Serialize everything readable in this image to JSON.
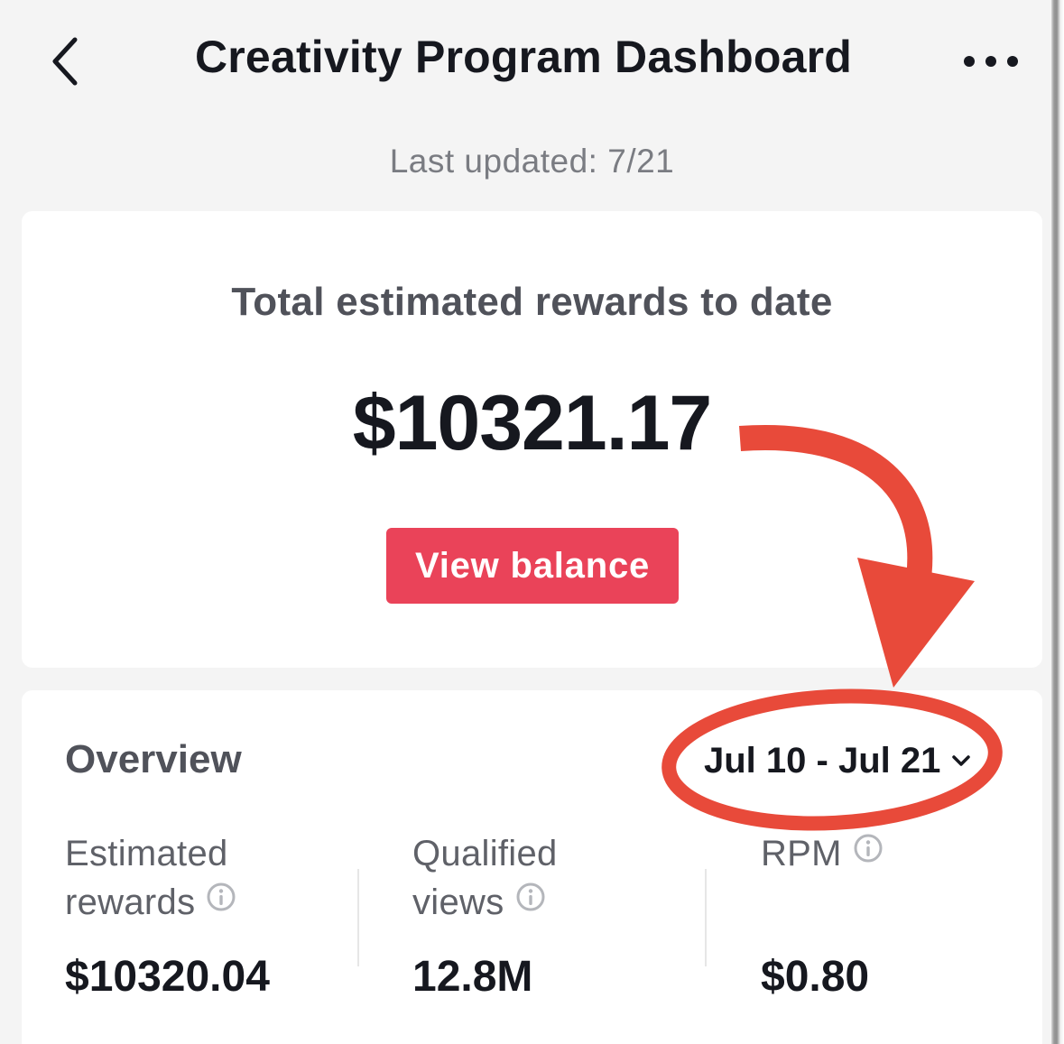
{
  "header": {
    "title": "Creativity Program Dashboard",
    "back_icon": "chevron-left-icon",
    "more_icon": "more-horizontal-icon"
  },
  "last_updated": "Last updated: 7/21",
  "rewards_card": {
    "heading": "Total estimated rewards to date",
    "total": "$10321.17",
    "button_label": "View balance"
  },
  "overview": {
    "title": "Overview",
    "date_range": "Jul 10 - Jul 21",
    "metrics": [
      {
        "label_line1": "Estimated",
        "label_line2": "rewards",
        "value": "$10320.04"
      },
      {
        "label_line1": "Qualified",
        "label_line2": "views",
        "value": "12.8M"
      },
      {
        "label_line1": "RPM",
        "label_line2": "",
        "value": "$0.80"
      }
    ]
  },
  "colors": {
    "accent": "#ea4359",
    "annotation": "#e84a3a",
    "background": "#f4f4f4",
    "card": "#ffffff",
    "text_primary": "#16181f",
    "text_secondary": "#5f6168"
  }
}
